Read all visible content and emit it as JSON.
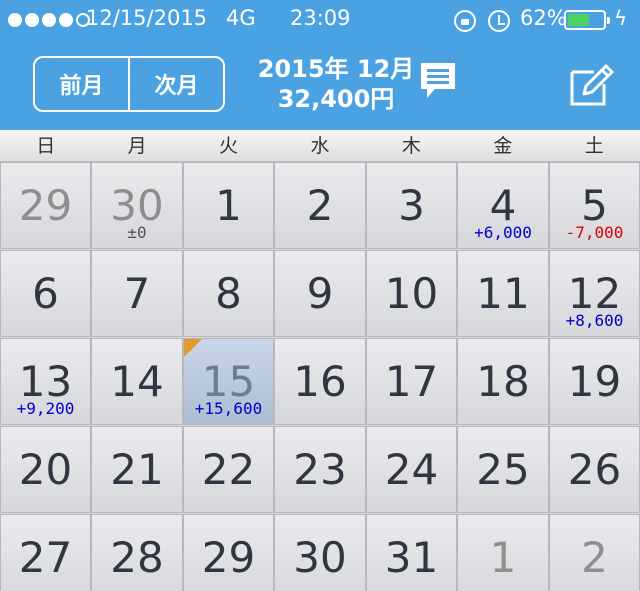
{
  "status_bar": {
    "date": "12/15/2015",
    "network": "4G",
    "time": "23:09",
    "battery_percent": "62%",
    "battery_level": 0.62,
    "signal_bars": 4,
    "signal_max": 5,
    "bolt": "ϟ"
  },
  "nav": {
    "prev_label": "前月",
    "next_label": "次月"
  },
  "summary": {
    "month": "2015年 12月",
    "total": "32,400円"
  },
  "weekdays": [
    "日",
    "月",
    "火",
    "水",
    "木",
    "金",
    "土"
  ],
  "calendar": [
    [
      {
        "day": "29",
        "other": true
      },
      {
        "day": "30",
        "other": true,
        "amount": "±0",
        "kind": "zero"
      },
      {
        "day": "1"
      },
      {
        "day": "2"
      },
      {
        "day": "3"
      },
      {
        "day": "4",
        "amount": "+6,000",
        "kind": "pos"
      },
      {
        "day": "5",
        "amount": "-7,000",
        "kind": "neg"
      }
    ],
    [
      {
        "day": "6"
      },
      {
        "day": "7"
      },
      {
        "day": "8"
      },
      {
        "day": "9"
      },
      {
        "day": "10"
      },
      {
        "day": "11"
      },
      {
        "day": "12",
        "amount": "+8,600",
        "kind": "pos"
      }
    ],
    [
      {
        "day": "13",
        "amount": "+9,200",
        "kind": "pos"
      },
      {
        "day": "14"
      },
      {
        "day": "15",
        "amount": "+15,600",
        "kind": "pos",
        "today": true
      },
      {
        "day": "16"
      },
      {
        "day": "17"
      },
      {
        "day": "18"
      },
      {
        "day": "19"
      }
    ],
    [
      {
        "day": "20"
      },
      {
        "day": "21"
      },
      {
        "day": "22"
      },
      {
        "day": "23"
      },
      {
        "day": "24"
      },
      {
        "day": "25"
      },
      {
        "day": "26"
      }
    ],
    [
      {
        "day": "27"
      },
      {
        "day": "28"
      },
      {
        "day": "29"
      },
      {
        "day": "30"
      },
      {
        "day": "31"
      },
      {
        "day": "1",
        "other": true
      },
      {
        "day": "2",
        "other": true
      }
    ]
  ],
  "colors": {
    "header": "#4aa2e2",
    "positive": "#0000cc",
    "negative": "#e00000",
    "today_flag": "#e59a2d"
  },
  "icons": [
    "lock-rotation-icon",
    "alarm-icon",
    "battery-icon",
    "memo-icon",
    "edit-icon"
  ]
}
